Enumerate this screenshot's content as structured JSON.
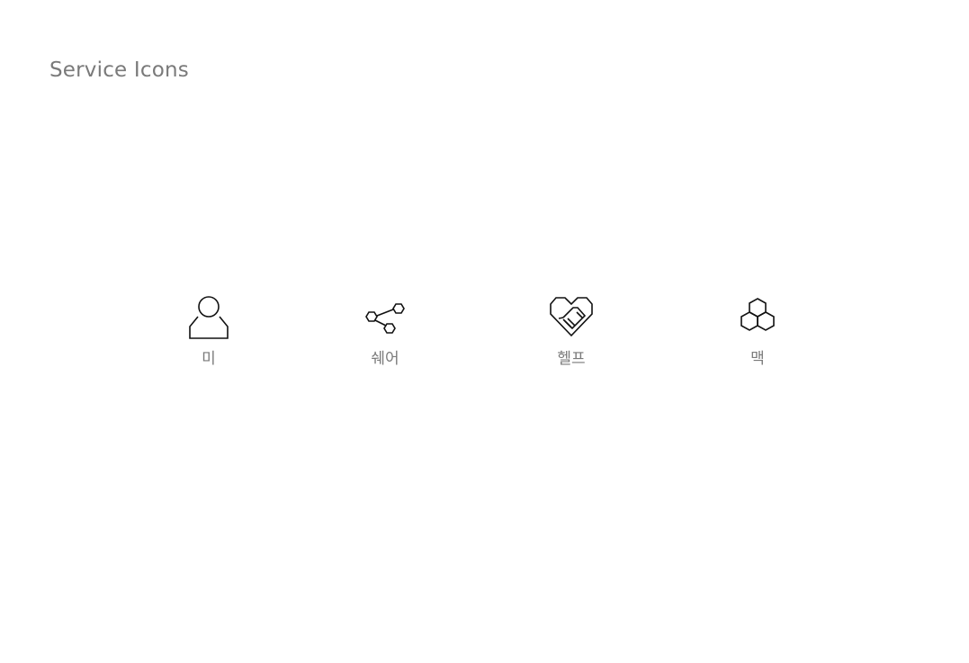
{
  "page": {
    "title": "Service Icons"
  },
  "icons": [
    {
      "id": "me",
      "icon": "person-icon",
      "label": "미"
    },
    {
      "id": "share",
      "icon": "share-icon",
      "label": "쉐어"
    },
    {
      "id": "help",
      "icon": "heart-handshake-icon",
      "label": "헬프"
    },
    {
      "id": "mac",
      "icon": "hexagon-cluster-icon",
      "label": "맥"
    }
  ],
  "colors": {
    "label": "#7a7a7a",
    "icon_stroke": "#111111",
    "background": "#ffffff"
  }
}
